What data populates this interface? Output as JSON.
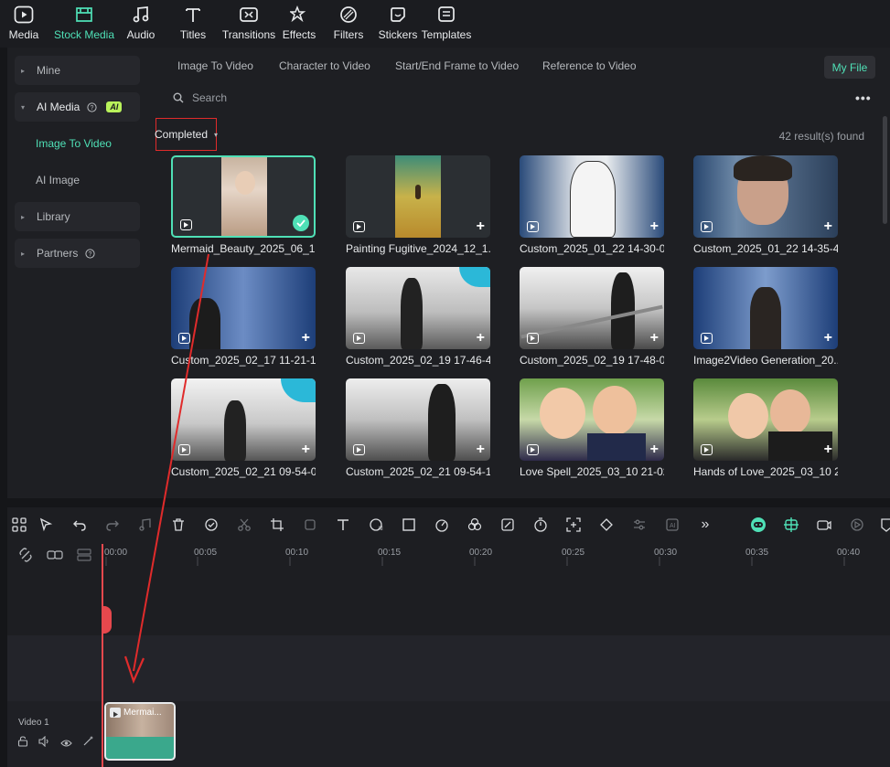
{
  "toolbar": {
    "items": [
      {
        "label": "Media",
        "icon": "media-icon"
      },
      {
        "label": "Stock Media",
        "icon": "stock-media-icon",
        "active": true
      },
      {
        "label": "Audio",
        "icon": "audio-icon"
      },
      {
        "label": "Titles",
        "icon": "titles-icon"
      },
      {
        "label": "Transitions",
        "icon": "transitions-icon"
      },
      {
        "label": "Effects",
        "icon": "effects-icon"
      },
      {
        "label": "Filters",
        "icon": "filters-icon"
      },
      {
        "label": "Stickers",
        "icon": "stickers-icon"
      },
      {
        "label": "Templates",
        "icon": "templates-icon"
      }
    ]
  },
  "sidebar": {
    "mine": "Mine",
    "ai_media": "AI Media",
    "ai_badge": "AI",
    "image_to_video": "Image To Video",
    "ai_image": "AI Image",
    "library": "Library",
    "partners": "Partners"
  },
  "tabs": {
    "image_to_video": "Image To Video",
    "character_to_video": "Character to Video",
    "start_end_frame": "Start/End Frame to Video",
    "reference_to_video": "Reference to Video",
    "my_file": "My File"
  },
  "search": {
    "placeholder": "Search"
  },
  "filter": {
    "selected": "Completed"
  },
  "results": {
    "count_text": "42 result(s) found"
  },
  "cards": [
    {
      "name": "Mermaid_Beauty_2025_06_1..."
    },
    {
      "name": "Painting Fugitive_2024_12_1..."
    },
    {
      "name": "Custom_2025_01_22 14-30-0..."
    },
    {
      "name": "Custom_2025_01_22 14-35-4..."
    },
    {
      "name": "Custom_2025_02_17 11-21-1..."
    },
    {
      "name": "Custom_2025_02_19 17-46-4..."
    },
    {
      "name": "Custom_2025_02_19 17-48-0..."
    },
    {
      "name": "Image2Video Generation_20..."
    },
    {
      "name": "Custom_2025_02_21 09-54-0..."
    },
    {
      "name": "Custom_2025_02_21 09-54-1..."
    },
    {
      "name": "Love Spell_2025_03_10 21-02..."
    },
    {
      "name": "Hands of Love_2025_03_10 2..."
    }
  ],
  "timeline": {
    "ruler": [
      "00:00",
      "00:05",
      "00:10",
      "00:15",
      "00:20",
      "00:25",
      "00:30",
      "00:35",
      "00:40"
    ],
    "track_label": "Video 1",
    "clip_label": "Mermai..."
  },
  "colors": {
    "accent": "#4fe0b6",
    "playhead": "#e6484d",
    "annotation": "#e02b2b",
    "ai_badge": "#b9f25b"
  }
}
